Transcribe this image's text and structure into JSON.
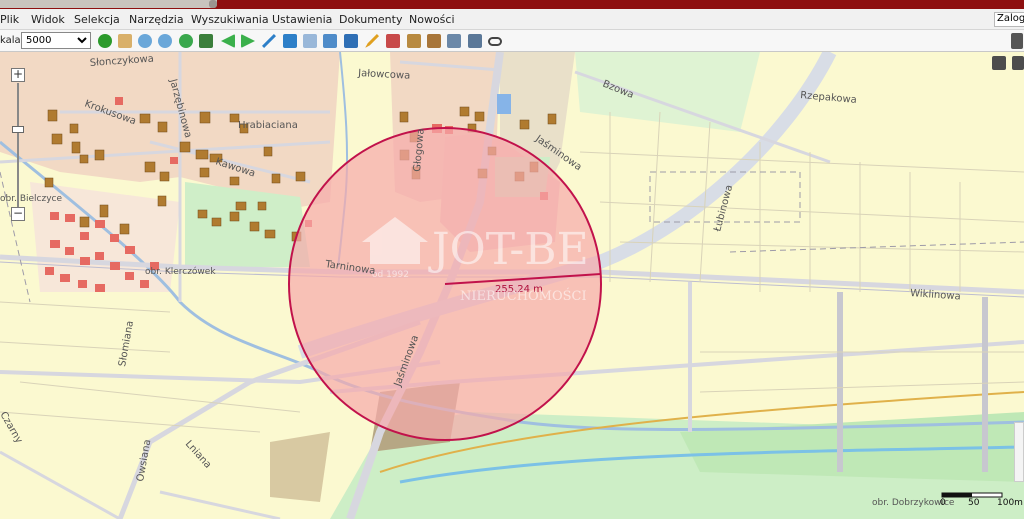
{
  "menu": {
    "items": [
      "Plik",
      "Widok",
      "Selekcja",
      "Narzędzia",
      "Wyszukiwania",
      "Ustawienia",
      "Dokumenty",
      "Nowości"
    ],
    "login_label": "Zalogu"
  },
  "toolbar": {
    "scale_label": "kala:",
    "scale_value": "5000",
    "tools": [
      "info-icon",
      "pan-hand-icon",
      "zoom-in-icon",
      "zoom-out-icon",
      "globe-icon",
      "zoom-extent-icon",
      "back-arrow-icon",
      "forward-arrow-icon",
      "measure-line-icon",
      "measure-area-icon",
      "print-icon",
      "layers-icon",
      "legend-icon",
      "draw-icon",
      "chart-icon",
      "save-icon",
      "report-icon",
      "export-icon",
      "link-icon"
    ]
  },
  "map": {
    "streets": {
      "slonczykowa": "Słonczykowa",
      "jarzebinowa": "Jarzębinowa",
      "krokusowa": "Krokusowa",
      "hrabiaciana": "Hrabiaciana",
      "kawowa": "Kawowa",
      "jalowcowa": "Jałowcowa",
      "glogowa": "Głogowa",
      "jasminowa_top": "Jaśminowa",
      "bzowa": "Bzowa",
      "rzepakowa": "Rzepakowa",
      "lubinowa": "Łubinowa",
      "tarninowa": "Tarninowa",
      "wiklinowa": "Wiklinowa",
      "jasminowa_bottom": "Jaśminowa",
      "slomiana": "Słomiana",
      "lniana": "Lniana",
      "owsiana": "Owsiana",
      "ozarzyny": "Czarny"
    },
    "precincts": {
      "obr_kleczowek": "obr. Klerczówek",
      "obr_bielczyce": "obr. Bielczyce",
      "obr_dobrzykowice": "obr. Dobrzykowice"
    },
    "measurement": "255.24 m",
    "watermark": {
      "brand": "JOT-BE",
      "subtitle": "NIERUCHOMOŚCI",
      "year": "od 1992"
    },
    "scale_bar": [
      "0",
      "50",
      "100m"
    ],
    "colors": {
      "residential": "#f2d9c4",
      "field": "#fbf9d0",
      "green": "#cfeec8",
      "building": "#b07b30",
      "building_alt": "#e66a62",
      "circle_fill": "#f6a9ab",
      "circle_stroke": "#c1124b",
      "road": "#d7d7df"
    }
  }
}
